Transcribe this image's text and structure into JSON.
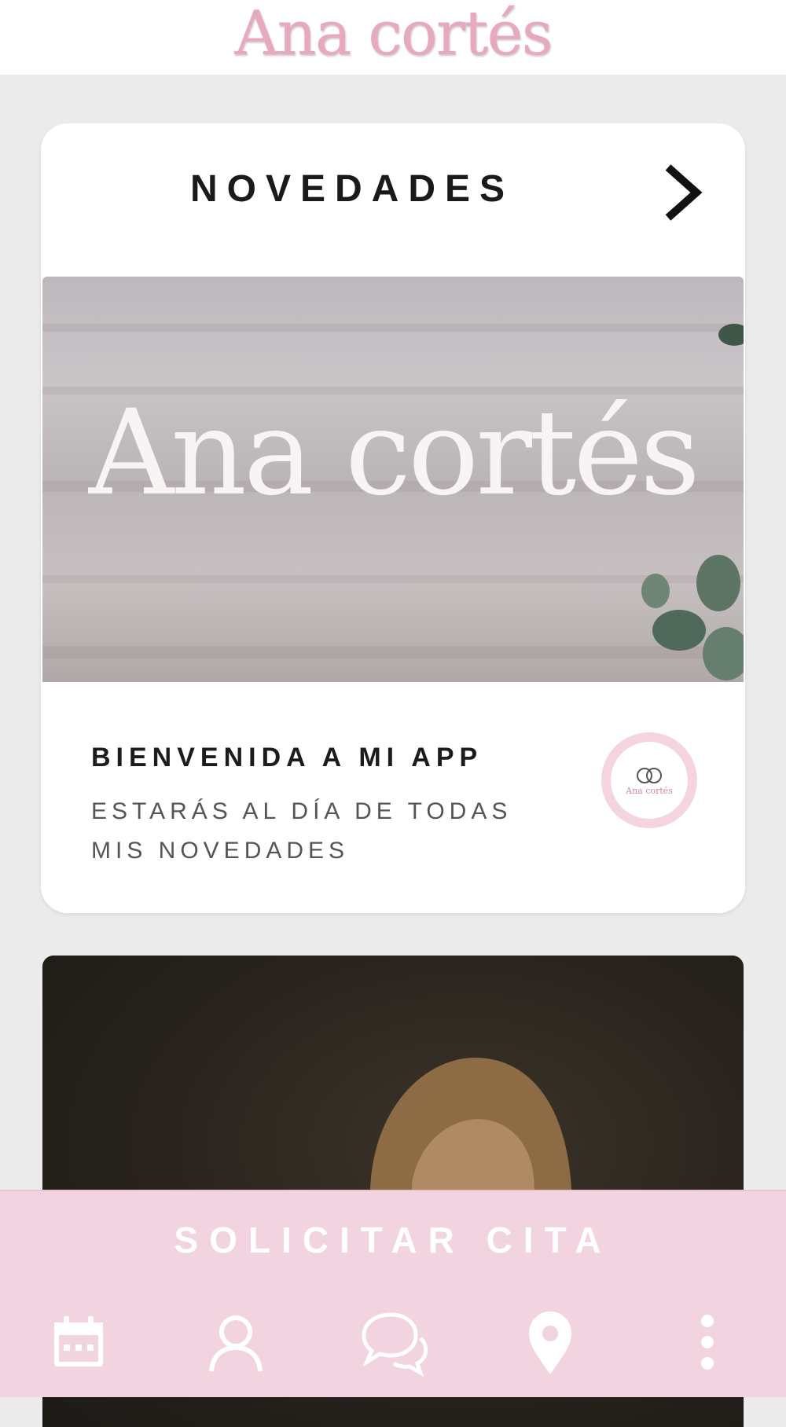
{
  "header": {
    "logo_text": "Ana cortés"
  },
  "news": {
    "title": "NOVEDADES",
    "hero_logo_text": "Ana cortés",
    "post": {
      "title": "BIENVENIDA A MI APP",
      "description_line1": "ESTARÁS AL DÍA DE TODAS",
      "description_line2": "MIS NOVEDADES",
      "avatar_text": "Ana cortés"
    }
  },
  "cta": {
    "label": "SOLICITAR CITA"
  },
  "bottom_nav": {
    "items": [
      {
        "name": "calendar",
        "icon": "calendar-icon"
      },
      {
        "name": "profile",
        "icon": "user-icon"
      },
      {
        "name": "chat",
        "icon": "chat-icon"
      },
      {
        "name": "location",
        "icon": "map-pin-icon"
      },
      {
        "name": "more",
        "icon": "more-vertical-icon"
      }
    ]
  },
  "colors": {
    "brand_pink": "#f2d3e0",
    "logo_pink": "#e6a9c0",
    "background": "#ebebeb"
  }
}
